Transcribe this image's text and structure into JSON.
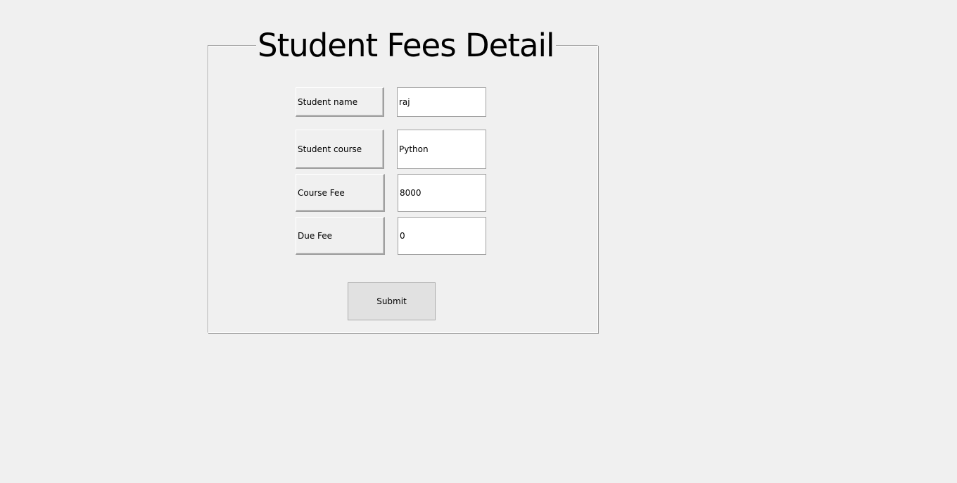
{
  "form": {
    "title": "Student Fees Detail",
    "fields": [
      {
        "label": "Student name",
        "value": "raj"
      },
      {
        "label": "Student course",
        "value": "Python"
      },
      {
        "label": "Course Fee",
        "value": "8000"
      },
      {
        "label": "Due Fee",
        "value": "0"
      }
    ],
    "submit_label": "Submit"
  }
}
